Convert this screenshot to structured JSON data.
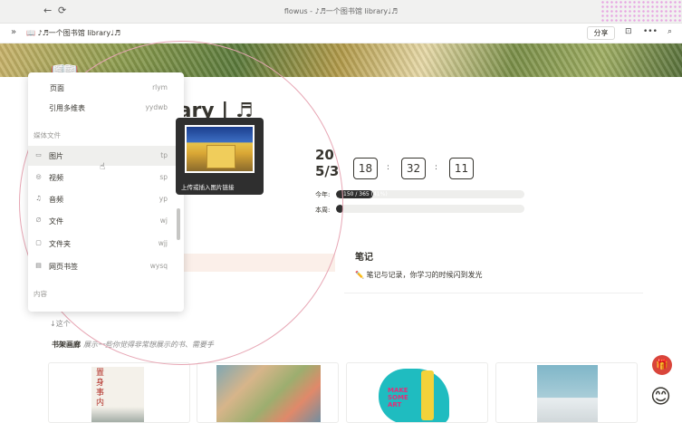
{
  "window": {
    "title": "flowus - ♪♬一个图书馆 library♩♬",
    "back": "←",
    "refresh": "⟳"
  },
  "toolbar": {
    "expand": "»",
    "breadcrumb": "📖 ♪♬一个图书馆 library♩♬",
    "share": "分享",
    "bookmark": "⊡",
    "more": "•••",
    "search": "⌕"
  },
  "page": {
    "icon": "📖",
    "title": "brary | ♬"
  },
  "clock": {
    "year": "20",
    "date": "5/3",
    "hour": "18",
    "minute": "32",
    "second": "11",
    "sep": ":"
  },
  "progress": {
    "year_label": "今年:",
    "year_value": 0.41,
    "year_text": "150 / 365 (41%)",
    "week_label": "本周:",
    "week_value": 0.02
  },
  "notes": {
    "title": "笔记",
    "text": "✏️ 笔记与记录，你学习的时候闪到发光"
  },
  "shelf": {
    "title": "书架画廊",
    "desc": "展示一些你觉得非常想展示的书、需要手"
  },
  "stray_text": "↓这个",
  "menu": {
    "items_top": [
      {
        "label": "页面",
        "shortcut": "rlym"
      },
      {
        "label": "引用多维表",
        "shortcut": "yydwb"
      }
    ],
    "section_media": "媒体文件",
    "items_media": [
      {
        "label": "图片",
        "shortcut": "tp",
        "icon": "image-icon",
        "glyph": "▭"
      },
      {
        "label": "视频",
        "shortcut": "sp",
        "icon": "video-icon",
        "glyph": "◎"
      },
      {
        "label": "音频",
        "shortcut": "yp",
        "icon": "audio-icon",
        "glyph": "♫"
      },
      {
        "label": "文件",
        "shortcut": "wj",
        "icon": "file-icon",
        "glyph": "∅"
      },
      {
        "label": "文件夹",
        "shortcut": "wjj",
        "icon": "folder-icon",
        "glyph": "▢"
      },
      {
        "label": "网页书签",
        "shortcut": "wysq",
        "icon": "bookmark-icon",
        "glyph": "▤"
      }
    ],
    "section_content": "内容"
  },
  "tooltip": {
    "text": "上传或插入图片链接"
  },
  "floating": {
    "gift": "🎁",
    "helper": "😊"
  }
}
